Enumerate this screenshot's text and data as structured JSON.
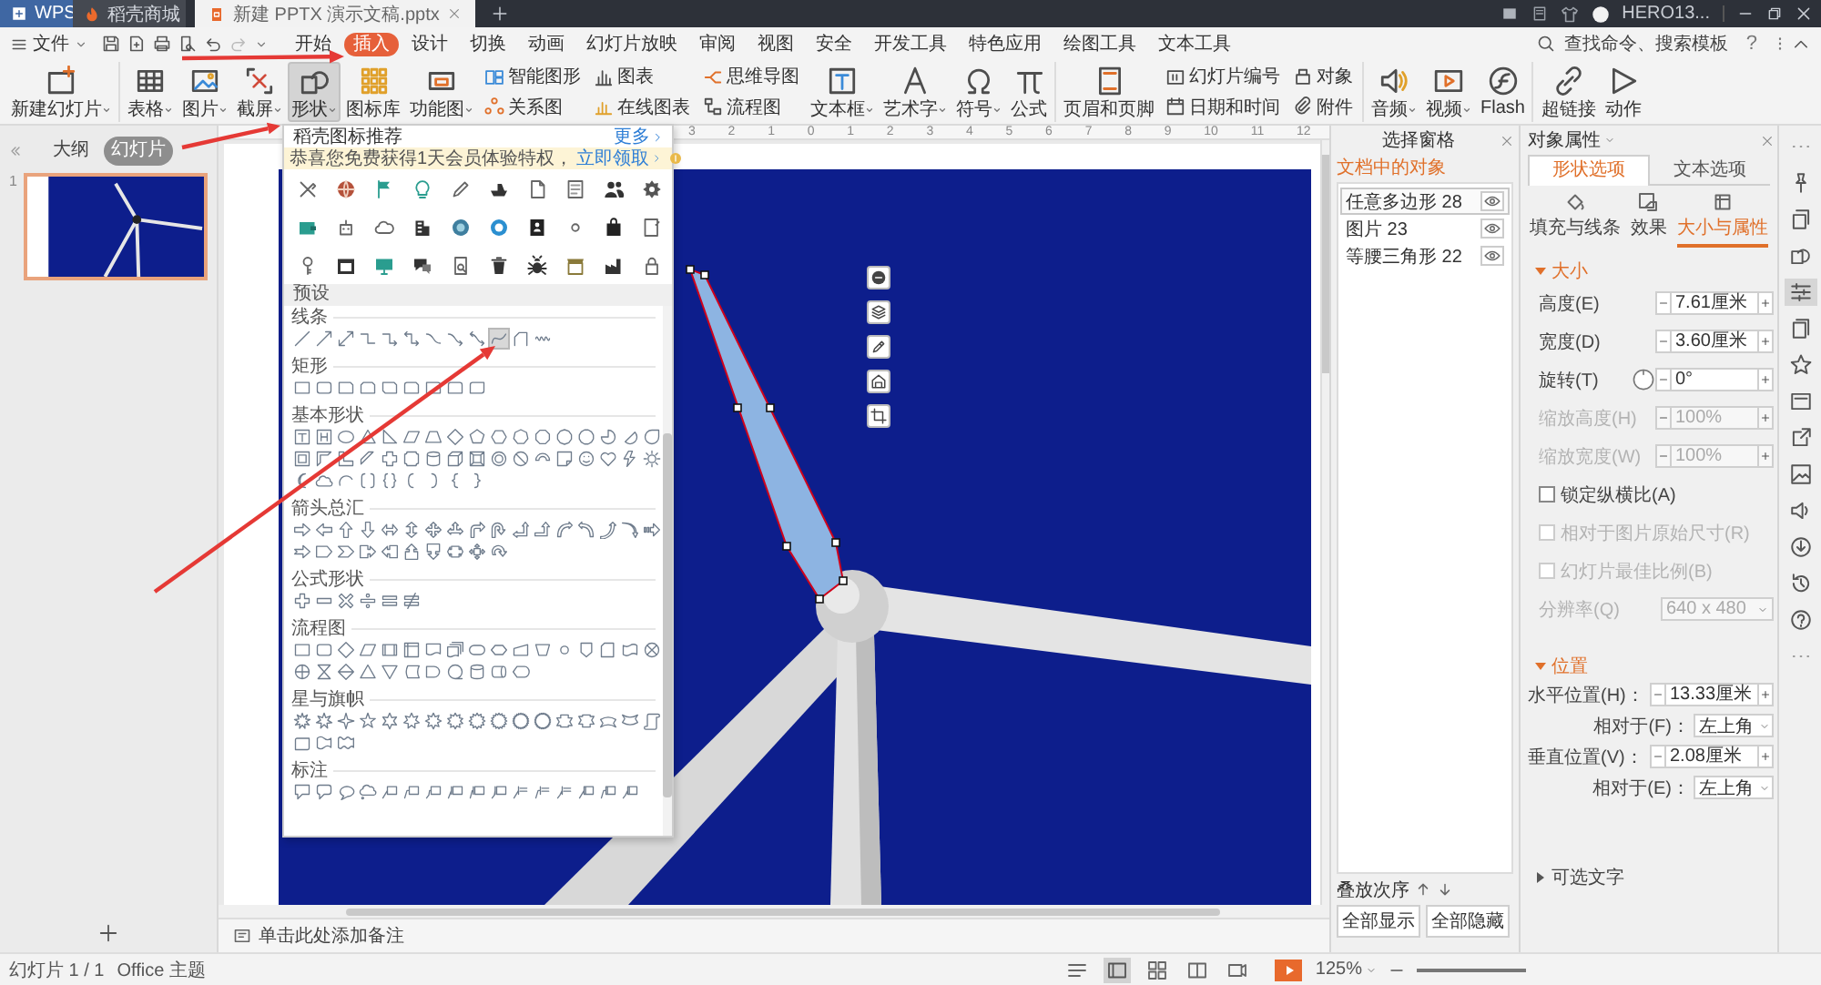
{
  "title_bar": {
    "tabs": [
      {
        "kind": "home",
        "label": "WPS",
        "selected": false
      },
      {
        "kind": "store",
        "label": "稻壳商城",
        "selected": false
      },
      {
        "kind": "document",
        "label": "新建 PPTX 演示文稿.pptx",
        "selected": true
      }
    ],
    "user": "HERO13..."
  },
  "menu_bar": {
    "file": "文件",
    "tabs": [
      {
        "label": "开始",
        "selected": false
      },
      {
        "label": "插入",
        "selected": true
      },
      {
        "label": "设计",
        "selected": false
      },
      {
        "label": "切换",
        "selected": false
      },
      {
        "label": "动画",
        "selected": false
      },
      {
        "label": "幻灯片放映",
        "selected": false
      },
      {
        "label": "审阅",
        "selected": false
      },
      {
        "label": "视图",
        "selected": false
      },
      {
        "label": "安全",
        "selected": false
      },
      {
        "label": "开发工具",
        "selected": false
      },
      {
        "label": "特色应用",
        "selected": false
      },
      {
        "label": "绘图工具",
        "selected": false
      },
      {
        "label": "文本工具",
        "selected": false
      }
    ],
    "search": {
      "placeholder": "查找命令、搜索模板"
    },
    "help": "?"
  },
  "ribbon": {
    "groups": [
      {
        "buttons": [
          {
            "kind": "large",
            "label": "新建幻灯片",
            "dropdown": true,
            "selected": false
          }
        ]
      },
      {
        "buttons": [
          {
            "kind": "large",
            "label": "表格",
            "dropdown": true,
            "selected": false
          },
          {
            "kind": "large",
            "label": "图片",
            "dropdown": true,
            "selected": false
          },
          {
            "kind": "large",
            "label": "截屏",
            "dropdown": true,
            "selected": false
          },
          {
            "kind": "large",
            "label": "形状",
            "dropdown": true,
            "selected": true
          },
          {
            "kind": "large",
            "label": "图标库",
            "dropdown": false,
            "selected": false
          },
          {
            "kind": "large",
            "label": "功能图",
            "dropdown": true,
            "selected": false
          },
          {
            "kind": "small",
            "label": "智能图形",
            "dropdown": false,
            "selected": false
          },
          {
            "kind": "small",
            "label": "关系图",
            "dropdown": false,
            "selected": false
          },
          {
            "kind": "small",
            "label": "图表",
            "dropdown": false,
            "selected": false
          },
          {
            "kind": "small",
            "label": "在线图表",
            "dropdown": false,
            "selected": false
          },
          {
            "kind": "small",
            "label": "思维导图",
            "dropdown": false,
            "selected": false
          },
          {
            "kind": "small",
            "label": "流程图",
            "dropdown": false,
            "selected": false
          },
          {
            "kind": "large",
            "label": "文本框",
            "dropdown": true,
            "selected": false
          },
          {
            "kind": "large",
            "label": "艺术字",
            "dropdown": true,
            "selected": false
          },
          {
            "kind": "large",
            "label": "符号",
            "dropdown": true,
            "selected": false
          },
          {
            "kind": "large",
            "label": "公式",
            "dropdown": false,
            "selected": false
          }
        ]
      },
      {
        "buttons": [
          {
            "kind": "large",
            "label": "页眉和页脚",
            "dropdown": false,
            "selected": false
          },
          {
            "kind": "small",
            "label": "幻灯片编号",
            "dropdown": false,
            "selected": false
          },
          {
            "kind": "small",
            "label": "日期和时间",
            "dropdown": false,
            "selected": false
          },
          {
            "kind": "small",
            "label": "对象",
            "dropdown": false,
            "selected": false
          },
          {
            "kind": "small",
            "label": "附件",
            "dropdown": false,
            "selected": false
          }
        ]
      },
      {
        "buttons": [
          {
            "kind": "large",
            "label": "音频",
            "dropdown": true,
            "selected": false
          },
          {
            "kind": "large",
            "label": "视频",
            "dropdown": true,
            "selected": false
          },
          {
            "kind": "large",
            "label": "Flash",
            "dropdown": false,
            "selected": false
          }
        ]
      },
      {
        "buttons": [
          {
            "kind": "large",
            "label": "超链接",
            "dropdown": false,
            "selected": false
          },
          {
            "kind": "large",
            "label": "动作",
            "dropdown": false,
            "selected": false
          }
        ]
      }
    ]
  },
  "slide_panel": {
    "tabs": [
      {
        "label": "大纲",
        "selected": false
      },
      {
        "label": "幻灯片",
        "selected": true
      }
    ],
    "slides": [
      {
        "number": "1",
        "selected": true
      }
    ]
  },
  "editor": {
    "ruler": [
      "3",
      "2",
      "1",
      "0",
      "1",
      "2",
      "3",
      "4",
      "5",
      "6",
      "7",
      "8",
      "9",
      "10",
      "11",
      "12"
    ],
    "notes": {
      "placeholder": "单击此处添加备注"
    }
  },
  "shape_menu": {
    "title": "稻壳图标推荐",
    "more": "更多",
    "promo": {
      "text": "恭喜您免费获得1天会员体验特权，",
      "link": "立即领取"
    },
    "icons": [
      {
        "kind": "tools"
      },
      {
        "kind": "globe"
      },
      {
        "kind": "flag"
      },
      {
        "kind": "lightbulb"
      },
      {
        "kind": "pencil"
      },
      {
        "kind": "ship"
      },
      {
        "kind": "document"
      },
      {
        "kind": "checklist"
      },
      {
        "kind": "people"
      },
      {
        "kind": "gear"
      },
      {
        "kind": "wallet"
      },
      {
        "kind": "robot"
      },
      {
        "kind": "cloud"
      },
      {
        "kind": "building"
      },
      {
        "kind": "target"
      },
      {
        "kind": "badge"
      },
      {
        "kind": "contact-card"
      },
      {
        "kind": "ring"
      },
      {
        "kind": "shopping-bag"
      },
      {
        "kind": "notepad"
      },
      {
        "kind": "key"
      },
      {
        "kind": "calendar"
      },
      {
        "kind": "monitor"
      },
      {
        "kind": "chat"
      },
      {
        "kind": "search-document"
      },
      {
        "kind": "trash-can"
      },
      {
        "kind": "bug"
      },
      {
        "kind": "store"
      },
      {
        "kind": "factory"
      },
      {
        "kind": "padlock"
      }
    ],
    "preset": "预设",
    "sections": [
      {
        "title": "线条",
        "shapes": [
          {
            "kind": "line",
            "selected": false
          },
          {
            "kind": "arrow-line",
            "selected": false
          },
          {
            "kind": "double-arrow-line",
            "selected": false
          },
          {
            "kind": "elbow-connector",
            "selected": false
          },
          {
            "kind": "elbow-arrow-connector",
            "selected": false
          },
          {
            "kind": "elbow-double-arrow-connector",
            "selected": false
          },
          {
            "kind": "curved-connector",
            "selected": false
          },
          {
            "kind": "curved-arrow-connector",
            "selected": false
          },
          {
            "kind": "curved-double-arrow-connector",
            "selected": false
          },
          {
            "kind": "curve",
            "selected": true
          },
          {
            "kind": "freeform",
            "selected": false
          },
          {
            "kind": "scribble",
            "selected": false
          }
        ]
      },
      {
        "title": "矩形",
        "shapes": [
          {
            "kind": "rectangle"
          },
          {
            "kind": "rounded-rectangle"
          },
          {
            "kind": "snipped-rectangle"
          },
          {
            "kind": "double-snipped-rectangle"
          },
          {
            "kind": "diagonal-snipped-rectangle"
          },
          {
            "kind": "snip-round-rectangle"
          },
          {
            "kind": "one-round-rectangle"
          },
          {
            "kind": "top-round-rectangle"
          },
          {
            "kind": "diagonal-round-rectangle"
          }
        ]
      },
      {
        "title": "基本形状",
        "shapes": [
          {
            "kind": "text-box"
          },
          {
            "kind": "vertical-text-box"
          },
          {
            "kind": "oval"
          },
          {
            "kind": "triangle"
          },
          {
            "kind": "right-triangle"
          },
          {
            "kind": "parallelogram"
          },
          {
            "kind": "trapezoid"
          },
          {
            "kind": "diamond"
          },
          {
            "kind": "pentagon"
          },
          {
            "kind": "hexagon"
          },
          {
            "kind": "heptagon"
          },
          {
            "kind": "octagon"
          },
          {
            "kind": "decagon"
          },
          {
            "kind": "dodecagon"
          },
          {
            "kind": "pie"
          },
          {
            "kind": "chord"
          },
          {
            "kind": "teardrop"
          },
          {
            "kind": "frame"
          },
          {
            "kind": "half-frame"
          },
          {
            "kind": "l-shape"
          },
          {
            "kind": "diagonal-stripe"
          },
          {
            "kind": "cross"
          },
          {
            "kind": "plaque"
          },
          {
            "kind": "can"
          },
          {
            "kind": "cube"
          },
          {
            "kind": "bevel"
          },
          {
            "kind": "donut"
          },
          {
            "kind": "no-symbol"
          },
          {
            "kind": "block-arc"
          },
          {
            "kind": "folded-corner"
          },
          {
            "kind": "smiley"
          },
          {
            "kind": "heart"
          },
          {
            "kind": "lightning"
          },
          {
            "kind": "sun"
          },
          {
            "kind": "moon"
          },
          {
            "kind": "cloud"
          },
          {
            "kind": "arc"
          },
          {
            "kind": "double-bracket"
          },
          {
            "kind": "double-brace"
          },
          {
            "kind": "left-bracket"
          },
          {
            "kind": "right-bracket"
          },
          {
            "kind": "left-brace"
          },
          {
            "kind": "right-brace"
          }
        ]
      },
      {
        "title": "箭头总汇",
        "shapes": [
          {
            "kind": "right-arrow"
          },
          {
            "kind": "left-arrow"
          },
          {
            "kind": "up-arrow"
          },
          {
            "kind": "down-arrow"
          },
          {
            "kind": "left-right-arrow"
          },
          {
            "kind": "up-down-arrow"
          },
          {
            "kind": "quad-arrow"
          },
          {
            "kind": "left-right-up-arrow"
          },
          {
            "kind": "bent-arrow"
          },
          {
            "kind": "u-turn-arrow"
          },
          {
            "kind": "left-up-arrow"
          },
          {
            "kind": "bent-up-arrow"
          },
          {
            "kind": "curved-right-arrow"
          },
          {
            "kind": "curved-left-arrow"
          },
          {
            "kind": "curved-up-arrow"
          },
          {
            "kind": "curved-down-arrow"
          },
          {
            "kind": "striped-right-arrow"
          },
          {
            "kind": "notched-right-arrow"
          },
          {
            "kind": "pentagon-arrow"
          },
          {
            "kind": "chevron"
          },
          {
            "kind": "right-arrow-callout"
          },
          {
            "kind": "left-arrow-callout"
          },
          {
            "kind": "up-arrow-callout"
          },
          {
            "kind": "down-arrow-callout"
          },
          {
            "kind": "left-right-arrow-callout"
          },
          {
            "kind": "quad-arrow-callout"
          },
          {
            "kind": "circular-arrow"
          }
        ]
      },
      {
        "title": "公式形状",
        "shapes": [
          {
            "kind": "plus-sign"
          },
          {
            "kind": "minus-sign"
          },
          {
            "kind": "multiply-sign"
          },
          {
            "kind": "divide-sign"
          },
          {
            "kind": "equal-sign"
          },
          {
            "kind": "not-equal-sign"
          }
        ]
      },
      {
        "title": "流程图",
        "shapes": [
          {
            "kind": "flow-process"
          },
          {
            "kind": "flow-alternate-process"
          },
          {
            "kind": "flow-decision"
          },
          {
            "kind": "flow-data"
          },
          {
            "kind": "flow-predefined-process"
          },
          {
            "kind": "flow-internal-storage"
          },
          {
            "kind": "flow-document"
          },
          {
            "kind": "flow-multidocument"
          },
          {
            "kind": "flow-terminator"
          },
          {
            "kind": "flow-preparation"
          },
          {
            "kind": "flow-manual-input"
          },
          {
            "kind": "flow-manual-operation"
          },
          {
            "kind": "flow-connector"
          },
          {
            "kind": "flow-off-page-connector"
          },
          {
            "kind": "flow-card"
          },
          {
            "kind": "flow-punched-tape"
          },
          {
            "kind": "flow-summing-junction"
          },
          {
            "kind": "flow-or"
          },
          {
            "kind": "flow-collate"
          },
          {
            "kind": "flow-sort"
          },
          {
            "kind": "flow-extract"
          },
          {
            "kind": "flow-merge"
          },
          {
            "kind": "flow-stored-data"
          },
          {
            "kind": "flow-delay"
          },
          {
            "kind": "flow-sequential-storage"
          },
          {
            "kind": "flow-magnetic-disk"
          },
          {
            "kind": "flow-direct-access-storage"
          },
          {
            "kind": "flow-display"
          }
        ]
      },
      {
        "title": "星与旗帜",
        "shapes": [
          {
            "kind": "explosion"
          },
          {
            "kind": "explosion-small"
          },
          {
            "kind": "star-4"
          },
          {
            "kind": "star-5"
          },
          {
            "kind": "star-6"
          },
          {
            "kind": "star-7"
          },
          {
            "kind": "star-8"
          },
          {
            "kind": "star-10"
          },
          {
            "kind": "star-12"
          },
          {
            "kind": "star-16"
          },
          {
            "kind": "star-24"
          },
          {
            "kind": "star-32"
          },
          {
            "kind": "up-ribbon"
          },
          {
            "kind": "down-ribbon"
          },
          {
            "kind": "curved-up-ribbon"
          },
          {
            "kind": "curved-down-ribbon"
          },
          {
            "kind": "vertical-scroll"
          },
          {
            "kind": "horizontal-scroll"
          },
          {
            "kind": "wave"
          },
          {
            "kind": "double-wave"
          }
        ]
      },
      {
        "title": "标注",
        "shapes": [
          {
            "kind": "rectangular-callout"
          },
          {
            "kind": "rounded-callout"
          },
          {
            "kind": "oval-callout"
          },
          {
            "kind": "cloud-callout"
          },
          {
            "kind": "line-callout"
          },
          {
            "kind": "bent-line-callout"
          },
          {
            "kind": "double-bent-line-callout"
          },
          {
            "kind": "accent-line-callout"
          },
          {
            "kind": "accent-bent-line-callout"
          },
          {
            "kind": "accent-double-bent-line-callout"
          },
          {
            "kind": "borderless-line-callout"
          },
          {
            "kind": "borderless-bent-line-callout"
          },
          {
            "kind": "borderless-double-bent-line-callout"
          },
          {
            "kind": "bordered-accent-line-callout"
          },
          {
            "kind": "bordered-accent-bent-line-callout"
          },
          {
            "kind": "bordered-accent-double-bent-line-callout"
          }
        ]
      }
    ]
  },
  "selection_pane": {
    "title": "选择窗格",
    "heading": "文档中的对象",
    "objects": [
      {
        "name": "任意多边形 28",
        "selected": true,
        "visible": true
      },
      {
        "name": "图片 23",
        "selected": false,
        "visible": true
      },
      {
        "name": "等腰三角形 22",
        "selected": false,
        "visible": true
      }
    ],
    "order_label": "叠放次序",
    "buttons": [
      "全部显示",
      "全部隐藏"
    ]
  },
  "properties": {
    "title": "对象属性",
    "tabs": [
      {
        "label": "形状选项",
        "selected": true
      },
      {
        "label": "文本选项",
        "selected": false
      }
    ],
    "subtabs": [
      {
        "kind": "fill",
        "label": "填充与线条",
        "selected": false
      },
      {
        "kind": "effects",
        "label": "效果",
        "selected": false
      },
      {
        "kind": "size",
        "label": "大小与属性",
        "selected": true
      }
    ],
    "sections": [
      {
        "title": "大小",
        "expanded": true,
        "rows": [
          {
            "kind": "spinner",
            "label": "高度(E)",
            "value": "7.61厘米",
            "disabled": false
          },
          {
            "kind": "spinner",
            "label": "宽度(D)",
            "value": "3.60厘米",
            "disabled": false
          },
          {
            "kind": "dial",
            "label": "旋转(T)",
            "value": "0°",
            "disabled": false
          },
          {
            "kind": "spinner",
            "label": "缩放高度(H)",
            "value": "100%",
            "disabled": true
          },
          {
            "kind": "spinner",
            "label": "缩放宽度(W)",
            "value": "100%",
            "disabled": true
          },
          {
            "kind": "checkbox",
            "label": "锁定纵横比(A)",
            "checked": false,
            "disabled": false
          },
          {
            "kind": "checkbox",
            "label": "相对于图片原始尺寸(R)",
            "checked": false,
            "disabled": true
          },
          {
            "kind": "checkbox",
            "label": "幻灯片最佳比例(B)",
            "checked": false,
            "disabled": true
          },
          {
            "kind": "select",
            "label": "分辨率(Q)",
            "value": "640 x 480",
            "disabled": true
          }
        ]
      },
      {
        "title": "位置",
        "expanded": true,
        "rows": [
          {
            "kind": "spinner",
            "label": "水平位置(H)：",
            "value": "13.33厘米",
            "disabled": false
          },
          {
            "kind": "sub-select",
            "label": "相对于(F)：",
            "value": "左上角",
            "disabled": false
          },
          {
            "kind": "spinner",
            "label": "垂直位置(V)：",
            "value": "2.08厘米",
            "disabled": false
          },
          {
            "kind": "sub-select",
            "label": "相对于(E)：",
            "value": "左上角",
            "disabled": false
          }
        ]
      },
      {
        "title": "可选文字",
        "expanded": false
      }
    ]
  },
  "side_toolbar": [
    {
      "kind": "more",
      "selected": false
    },
    {
      "kind": "tack",
      "selected": false
    },
    {
      "kind": "duplicate",
      "selected": false
    },
    {
      "kind": "shapes",
      "selected": false
    },
    {
      "kind": "properties",
      "selected": true
    },
    {
      "kind": "files",
      "selected": false
    },
    {
      "kind": "star",
      "selected": false
    },
    {
      "kind": "panel",
      "selected": false
    },
    {
      "kind": "export",
      "selected": false
    },
    {
      "kind": "picture",
      "selected": false
    },
    {
      "kind": "speaker",
      "selected": false
    },
    {
      "kind": "download",
      "selected": false
    },
    {
      "kind": "history",
      "selected": false
    },
    {
      "kind": "help",
      "selected": false
    },
    {
      "kind": "more",
      "selected": false
    }
  ],
  "status_bar": {
    "slide": "幻灯片 1 / 1",
    "theme": "Office 主题",
    "views": [
      {
        "kind": "notes",
        "selected": false
      },
      {
        "kind": "normal",
        "selected": true
      },
      {
        "kind": "sorter",
        "selected": false
      },
      {
        "kind": "reading",
        "selected": false
      },
      {
        "kind": "presenter",
        "selected": false
      }
    ],
    "zoom": "125%"
  }
}
